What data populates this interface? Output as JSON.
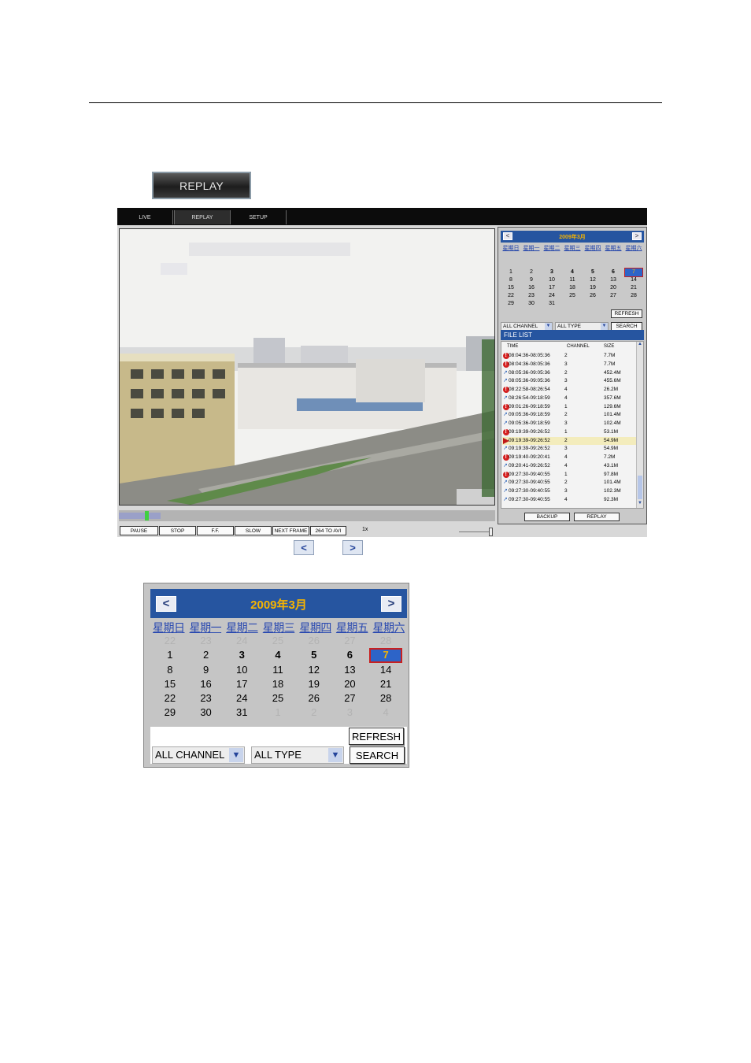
{
  "replay_button": "REPLAY",
  "tabs": [
    "LIVE",
    "REPLAY",
    "SETUP"
  ],
  "controls": {
    "buttons": [
      "PAUSE",
      "STOP",
      "F.F.",
      "SLOW",
      "NEXT FRAME",
      "264 TO AVI"
    ],
    "speed": "1x",
    "progress": 0.11
  },
  "calendar": {
    "prev": "<",
    "next": ">",
    "month": "2009年3月",
    "weekdays": [
      "星期日",
      "星期一",
      "星期二",
      "星期三",
      "星期四",
      "星期五",
      "星期六"
    ],
    "leading_days": [
      "22",
      "23",
      "24",
      "25",
      "26",
      "27",
      "28"
    ],
    "days": [
      "1",
      "2",
      "3",
      "4",
      "5",
      "6",
      "7",
      "8",
      "9",
      "10",
      "11",
      "12",
      "13",
      "14",
      "15",
      "16",
      "17",
      "18",
      "19",
      "20",
      "21",
      "22",
      "23",
      "24",
      "25",
      "26",
      "27",
      "28",
      "29",
      "30",
      "31"
    ],
    "trailing_days": [
      "1",
      "2",
      "3",
      "4"
    ],
    "bold_days": [
      "3",
      "4",
      "5",
      "6",
      "7"
    ],
    "selected_day": "7",
    "refresh": "REFRESH",
    "channel_select": "ALL CHANNEL",
    "type_select": "ALL TYPE",
    "search": "SEARCH"
  },
  "file_list": {
    "title": "FILE LIST",
    "columns": [
      "TIME",
      "CHANNEL",
      "SIZE"
    ],
    "rows": [
      {
        "icon": "alarm",
        "time": "08:04:36-08:05:36",
        "channel": "2",
        "size": "7.7M"
      },
      {
        "icon": "alarm",
        "time": "08:04:36-08:05:36",
        "channel": "3",
        "size": "7.7M"
      },
      {
        "icon": "schedule",
        "time": "08:05:36-09:05:36",
        "channel": "2",
        "size": "452.4M"
      },
      {
        "icon": "schedule",
        "time": "08:05:36-09:05:36",
        "channel": "3",
        "size": "455.6M"
      },
      {
        "icon": "alarm",
        "time": "08:22:58-08:26:54",
        "channel": "4",
        "size": "26.2M"
      },
      {
        "icon": "schedule",
        "time": "08:26:54-09:18:59",
        "channel": "4",
        "size": "357.6M"
      },
      {
        "icon": "alarm",
        "time": "09:01:26-09:18:59",
        "channel": "1",
        "size": "129.6M"
      },
      {
        "icon": "schedule",
        "time": "09:05:36-09:18:59",
        "channel": "2",
        "size": "101.4M"
      },
      {
        "icon": "schedule",
        "time": "09:05:36-09:18:59",
        "channel": "3",
        "size": "102.4M"
      },
      {
        "icon": "alarm",
        "time": "09:19:39-09:26:52",
        "channel": "1",
        "size": "53.1M"
      },
      {
        "icon": "playing",
        "time": "09:19:39-09:26:52",
        "channel": "2",
        "size": "54.9M"
      },
      {
        "icon": "schedule",
        "time": "09:19:39-09:26:52",
        "channel": "3",
        "size": "54.9M"
      },
      {
        "icon": "alarm",
        "time": "09:19:40-09:20:41",
        "channel": "4",
        "size": "7.2M"
      },
      {
        "icon": "schedule",
        "time": "09:20:41-09:26:52",
        "channel": "4",
        "size": "43.1M"
      },
      {
        "icon": "alarm",
        "time": "09:27:30-09:40:55",
        "channel": "1",
        "size": "97.8M"
      },
      {
        "icon": "schedule",
        "time": "09:27:30-09:40:55",
        "channel": "2",
        "size": "101.4M"
      },
      {
        "icon": "schedule",
        "time": "09:27:30-09:40:55",
        "channel": "3",
        "size": "102.3M"
      },
      {
        "icon": "schedule",
        "time": "09:27:30-09:40:55",
        "channel": "4",
        "size": "92.3M"
      }
    ],
    "backup": "BACKUP",
    "replay": "REPLAY"
  },
  "nav_arrows": [
    "<",
    ">"
  ]
}
